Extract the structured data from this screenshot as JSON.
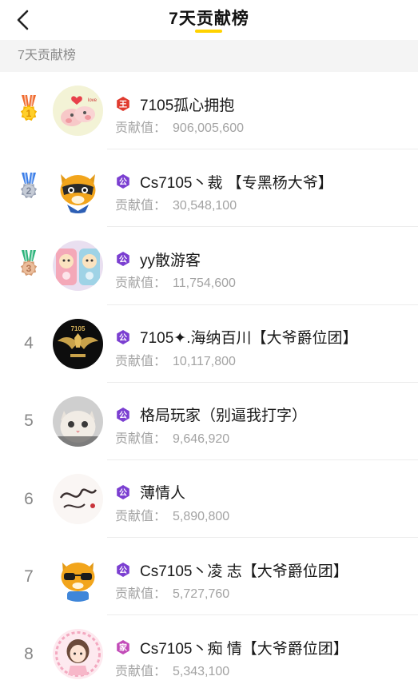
{
  "header": {
    "title": "7天贡献榜"
  },
  "section": {
    "label": "7天贡献榜"
  },
  "value_label": "贡献值：",
  "colors": {
    "accent": "#ffd200",
    "gold": "#f5b400",
    "silver": "#9aa3b5",
    "bronze": "#d49a72",
    "badge_guild": "#7b3fd1",
    "badge_king": "#e03a2e",
    "badge_pink": "#c24bb8"
  },
  "entries": [
    {
      "rank": "1",
      "name": "7105孤心拥抱",
      "value": "906,005,600",
      "badge_icon": "king-badge-icon",
      "avatar": "pig-cartoon-avatar"
    },
    {
      "rank": "2",
      "name": "Cs7105丶裁 【专黑杨大爷】",
      "value": "30,548,100",
      "badge_icon": "guild-badge-icon",
      "avatar": "raccoon-avatar"
    },
    {
      "rank": "3",
      "name": "yy散游客",
      "value": "11,754,600",
      "badge_icon": "guild-badge-icon",
      "avatar": "toy-bears-avatar"
    },
    {
      "rank": "4",
      "name": "7105✦.海纳百川【大爷爵位团】",
      "value": "10,117,800",
      "badge_icon": "guild-badge-icon",
      "avatar": "gold-wings-avatar"
    },
    {
      "rank": "5",
      "name": "格局玩家（别逼我打字）",
      "value": "9,646,920",
      "badge_icon": "guild-badge-icon",
      "avatar": "cat-avatar"
    },
    {
      "rank": "6",
      "name": "薄情人",
      "value": "5,890,800",
      "badge_icon": "guild-badge-icon",
      "avatar": "calligraphy-avatar"
    },
    {
      "rank": "7",
      "name": "Cs7105丶凌 志【大爷爵位团】",
      "value": "5,727,760",
      "badge_icon": "guild-badge-icon",
      "avatar": "raccoon-sunglasses-avatar"
    },
    {
      "rank": "8",
      "name": "Cs7105丶痴 情【大爷爵位团】",
      "value": "5,343,100",
      "badge_icon": "pink-badge-icon",
      "avatar": "girl-cartoon-avatar"
    }
  ]
}
